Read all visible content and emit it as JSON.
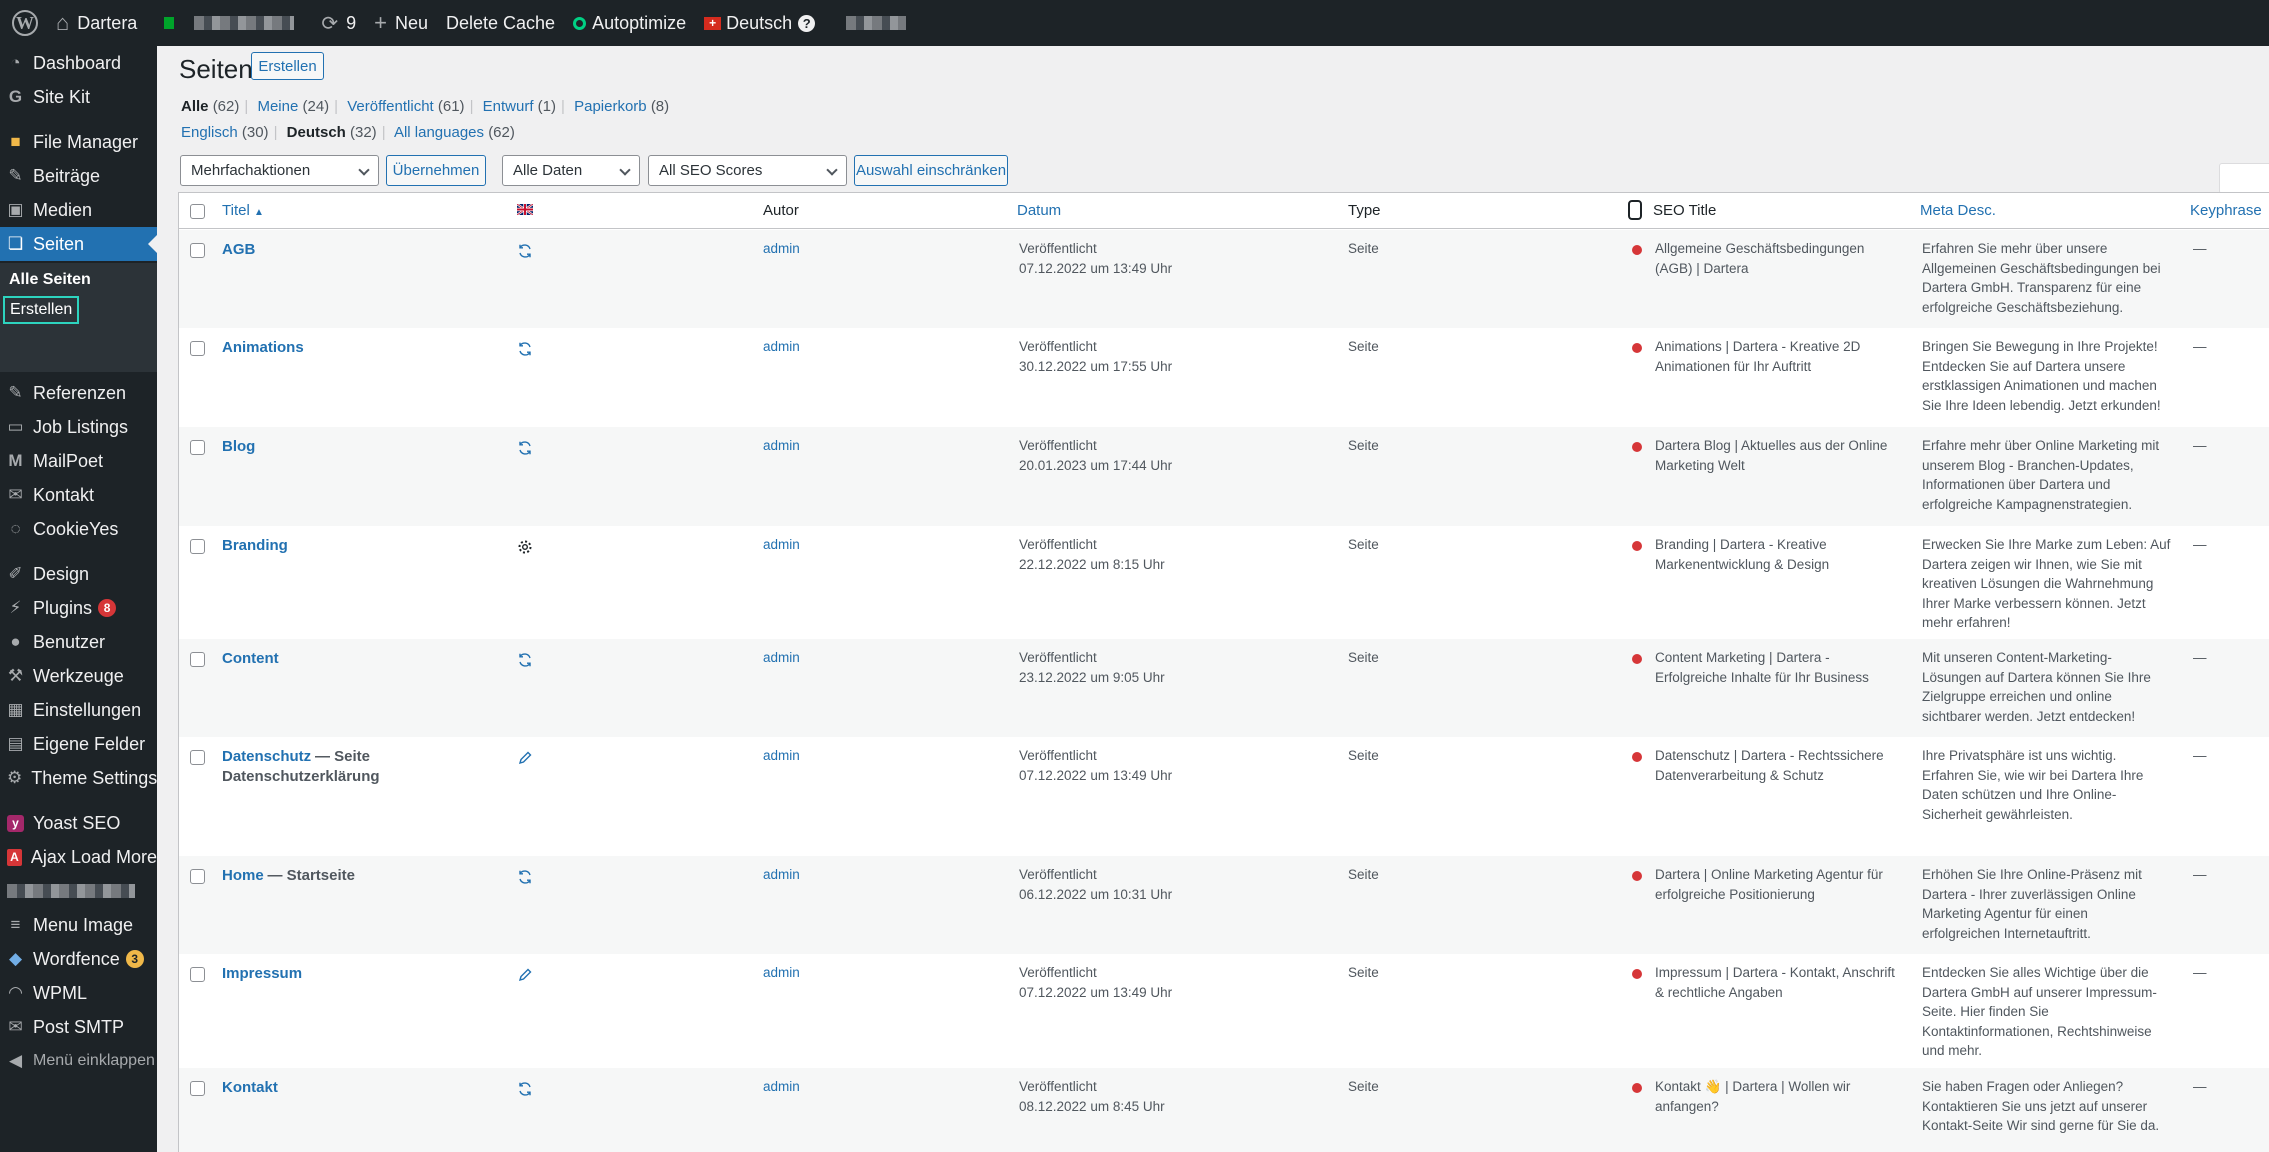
{
  "adminbar": {
    "site_name": "Dartera",
    "updates_count": "9",
    "new_label": "Neu",
    "delete_cache_label": "Delete Cache",
    "autoptimize_label": "Autoptimize",
    "language_label": "Deutsch",
    "help_label": "?"
  },
  "sidebar": {
    "items": [
      {
        "label": "Dashboard"
      },
      {
        "label": "Site Kit"
      },
      {
        "label": "File Manager"
      },
      {
        "label": "Beiträge"
      },
      {
        "label": "Medien"
      },
      {
        "label": "Seiten"
      },
      {
        "label": "Referenzen"
      },
      {
        "label": "Job Listings"
      },
      {
        "label": "MailPoet"
      },
      {
        "label": "Kontakt"
      },
      {
        "label": "CookieYes"
      },
      {
        "label": "Design"
      },
      {
        "label": "Plugins",
        "badge": "8"
      },
      {
        "label": "Benutzer"
      },
      {
        "label": "Werkzeuge"
      },
      {
        "label": "Einstellungen"
      },
      {
        "label": "Eigene Felder"
      },
      {
        "label": "Theme Settings"
      },
      {
        "label": "Yoast SEO"
      },
      {
        "label": "Ajax Load More"
      },
      {
        "label": "Menu Image"
      },
      {
        "label": "Wordfence",
        "badge": "3"
      },
      {
        "label": "WPML"
      },
      {
        "label": "Post SMTP"
      }
    ],
    "submenu": {
      "all_pages": "Alle Seiten",
      "create": "Erstellen"
    },
    "collapse_label": "Menü einklappen"
  },
  "page": {
    "title": "Seiten",
    "add_new_label": "Erstellen",
    "views": [
      {
        "label": "Alle",
        "count": "(62)"
      },
      {
        "label": "Meine",
        "count": "(24)"
      },
      {
        "label": "Veröffentlicht",
        "count": "(61)"
      },
      {
        "label": "Entwurf",
        "count": "(1)"
      },
      {
        "label": "Papierkorb",
        "count": "(8)"
      }
    ],
    "languages": [
      {
        "label": "Englisch",
        "count": "(30)"
      },
      {
        "label": "Deutsch",
        "count": "(32)"
      },
      {
        "label": "All languages",
        "count": "(62)"
      }
    ],
    "bulk_actions": "Mehrfachaktionen",
    "apply_label": "Übernehmen",
    "date_filter": "Alle Daten",
    "seo_filter": "All SEO Scores",
    "filter_label": "Auswahl einschränken"
  },
  "table": {
    "columns": {
      "title": "Titel",
      "author": "Autor",
      "date": "Datum",
      "type": "Type",
      "seo_title": "SEO Title",
      "meta_desc": "Meta Desc.",
      "keyphrase": "Keyphrase"
    },
    "rows": [
      {
        "title": "AGB",
        "state": "",
        "icon": "sync-icon",
        "author": "admin",
        "status": "Veröffentlicht",
        "date": "07.12.2022 um 13:49 Uhr",
        "type": "Seite",
        "seo": [
          "Allgemeine Geschäftsbedingungen",
          "(AGB) | Dartera"
        ],
        "meta": [
          "Erfahren Sie mehr über unsere",
          "Allgemeinen Geschäftsbedingungen bei",
          "Dartera GmbH. Transparenz für eine",
          "erfolgreiche Geschäftsbeziehung."
        ],
        "keyphrase": "—"
      },
      {
        "title": "Animations",
        "state": "",
        "icon": "sync-icon",
        "author": "admin",
        "status": "Veröffentlicht",
        "date": "30.12.2022 um 17:55 Uhr",
        "type": "Seite",
        "seo": [
          "Animations | Dartera - Kreative 2D",
          "Animationen für Ihr Auftritt"
        ],
        "meta": [
          "Bringen Sie Bewegung in Ihre Projekte!",
          "Entdecken Sie auf Dartera unsere",
          "erstklassigen Animationen und machen",
          "Sie Ihre Ideen lebendig. Jetzt erkunden!"
        ],
        "keyphrase": "—"
      },
      {
        "title": "Blog",
        "state": "",
        "icon": "sync-icon",
        "author": "admin",
        "status": "Veröffentlicht",
        "date": "20.01.2023 um 17:44 Uhr",
        "type": "Seite",
        "seo": [
          "Dartera Blog | Aktuelles aus der Online",
          "Marketing Welt"
        ],
        "meta": [
          "Erfahre mehr über Online Marketing mit",
          "unserem Blog - Branchen-Updates,",
          "Informationen über Dartera und",
          "erfolgreiche Kampagnenstrategien."
        ],
        "keyphrase": "—"
      },
      {
        "title": "Branding",
        "state": "",
        "icon": "gear-icon",
        "author": "admin",
        "status": "Veröffentlicht",
        "date": "22.12.2022 um 8:15 Uhr",
        "type": "Seite",
        "seo": [
          "Branding | Dartera - Kreative",
          "Markenentwicklung & Design"
        ],
        "meta": [
          "Erwecken Sie Ihre Marke zum Leben: Auf",
          "Dartera zeigen wir Ihnen, wie Sie mit",
          "kreativen Lösungen die Wahrnehmung",
          "Ihrer Marke verbessern können. Jetzt",
          "mehr erfahren!"
        ],
        "keyphrase": "—"
      },
      {
        "title": "Content",
        "state": "",
        "icon": "sync-icon",
        "author": "admin",
        "status": "Veröffentlicht",
        "date": "23.12.2022 um 9:05 Uhr",
        "type": "Seite",
        "seo": [
          "Content Marketing | Dartera -",
          "Erfolgreiche Inhalte für Ihr Business"
        ],
        "meta": [
          "Mit unseren Content-Marketing-",
          "Lösungen auf Dartera können Sie Ihre",
          "Zielgruppe erreichen und online",
          "sichtbarer werden. Jetzt entdecken!"
        ],
        "keyphrase": "—"
      },
      {
        "title": "Datenschutz",
        "state": "— Seite Datenschutzerklärung",
        "state_lines": [
          "— Seite",
          "Datenschutzerklärung"
        ],
        "icon": "pencil-icon",
        "author": "admin",
        "status": "Veröffentlicht",
        "date": "07.12.2022 um 13:49 Uhr",
        "type": "Seite",
        "seo": [
          "Datenschutz | Dartera - Rechtssichere",
          "Datenverarbeitung & Schutz"
        ],
        "meta": [
          "Ihre Privatsphäre ist uns wichtig.",
          "Erfahren Sie, wie wir bei Dartera Ihre",
          "Daten schützen und Ihre Online-",
          "Sicherheit gewährleisten."
        ],
        "keyphrase": "—"
      },
      {
        "title": "Home",
        "state": "— Startseite",
        "icon": "sync-icon",
        "author": "admin",
        "status": "Veröffentlicht",
        "date": "06.12.2022 um 10:31 Uhr",
        "type": "Seite",
        "seo": [
          "Dartera | Online Marketing Agentur für",
          "erfolgreiche Positionierung"
        ],
        "meta": [
          "Erhöhen Sie Ihre Online-Präsenz mit",
          "Dartera - Ihrer zuverlässigen Online",
          "Marketing Agentur für einen",
          "erfolgreichen Internetauftritt."
        ],
        "keyphrase": "—"
      },
      {
        "title": "Impressum",
        "state": "",
        "icon": "pencil-icon",
        "author": "admin",
        "status": "Veröffentlicht",
        "date": "07.12.2022 um 13:49 Uhr",
        "type": "Seite",
        "seo": [
          "Impressum | Dartera - Kontakt, Anschrift",
          "& rechtliche Angaben"
        ],
        "meta": [
          "Entdecken Sie alles Wichtige über die",
          "Dartera GmbH auf unserer Impressum-",
          "Seite. Hier finden Sie",
          "Kontaktinformationen, Rechtshinweise",
          "und mehr."
        ],
        "keyphrase": "—"
      },
      {
        "title": "Kontakt",
        "state": "",
        "icon": "sync-icon",
        "author": "admin",
        "status": "Veröffentlicht",
        "date": "08.12.2022 um 8:45 Uhr",
        "type": "Seite",
        "seo": [
          "Kontakt 👋 | Dartera | Wollen wir",
          "anfangen?"
        ],
        "meta": [
          "Sie haben Fragen oder Anliegen?",
          "Kontaktieren Sie uns jetzt auf unserer",
          "Kontakt-Seite Wir sind gerne für Sie da."
        ],
        "keyphrase": "—"
      }
    ]
  },
  "colors": {
    "accent": "#2271b1",
    "sidebar": "#1d2327",
    "active": "#2271b1",
    "seo_dot": "#d63638"
  }
}
